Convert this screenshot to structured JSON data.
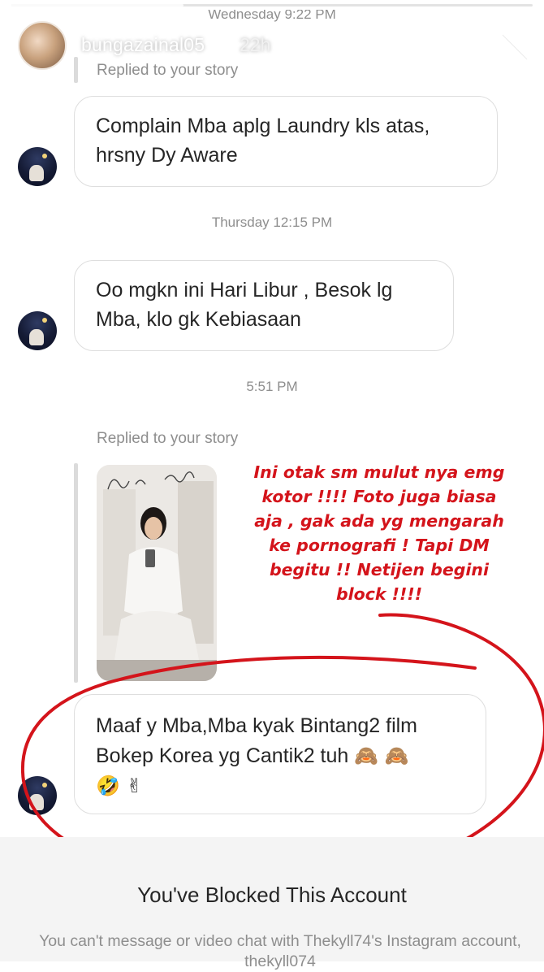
{
  "top_cut_text": "Wednesday 9:22 PM",
  "story": {
    "username": "bungazainal05",
    "time": "22h"
  },
  "messages": [
    {
      "replied_label": "Replied to your story",
      "text": "Complain Mba aplg Laundry kls atas, hrsny Dy Aware"
    },
    {
      "timestamp": "Thursday 12:15 PM",
      "text": "Oo mgkn ini Hari Libur , Besok lg Mba, klo gk Kebiasaan"
    },
    {
      "timestamp": "5:51 PM",
      "replied_label": "Replied to your story",
      "text_line1": "Maaf y Mba,Mba kyak Bintang2 film",
      "text_line2": "Bokep Korea yg Cantik2 tuh",
      "emoji_line2": "🙈 🙈",
      "emoji_line3": "🤣 ✌"
    }
  ],
  "annotation": "Ini otak sm mulut nya emg\nkotor !!!! Foto juga biasa\naja , gak ada yg mengarah\nke pornografi ! Tapi DM\nbegitu !! Netijen begini\nblock !!!!",
  "blocked": {
    "title": "You've Blocked This Account",
    "description": "You can't message or video chat with Thekyll74's Instagram account, thekyll074"
  },
  "colors": {
    "annotation_red": "#d4141b",
    "bubble_border": "#dedede",
    "meta_gray": "#8e8e8e"
  }
}
